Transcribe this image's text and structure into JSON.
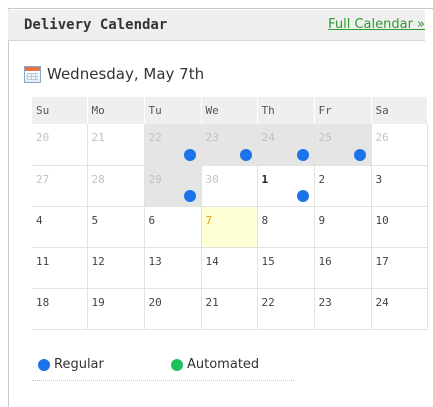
{
  "header": {
    "title": "Delivery Calendar",
    "full_calendar_link": "Full Calendar »"
  },
  "selected_date": "Wednesday, May 7th",
  "calendar": {
    "weekdays": [
      "Su",
      "Mo",
      "Tu",
      "We",
      "Th",
      "Fr",
      "Sa"
    ],
    "weeks": [
      [
        {
          "day": "20",
          "other": true
        },
        {
          "day": "21",
          "other": true
        },
        {
          "day": "22",
          "other": true,
          "shaded": true,
          "dot": "regular"
        },
        {
          "day": "23",
          "other": true,
          "shaded": true,
          "dot": "regular"
        },
        {
          "day": "24",
          "other": true,
          "shaded": true,
          "dot": "regular"
        },
        {
          "day": "25",
          "other": true,
          "shaded": true,
          "dot": "regular"
        },
        {
          "day": "26",
          "other": true
        }
      ],
      [
        {
          "day": "27",
          "other": true
        },
        {
          "day": "28",
          "other": true
        },
        {
          "day": "29",
          "other": true,
          "shaded": true,
          "dot": "regular"
        },
        {
          "day": "30",
          "other": true
        },
        {
          "day": "1",
          "first": true,
          "dot": "regular"
        },
        {
          "day": "2"
        },
        {
          "day": "3"
        }
      ],
      [
        {
          "day": "4"
        },
        {
          "day": "5"
        },
        {
          "day": "6"
        },
        {
          "day": "7",
          "today": true
        },
        {
          "day": "8"
        },
        {
          "day": "9"
        },
        {
          "day": "10"
        }
      ],
      [
        {
          "day": "11"
        },
        {
          "day": "12"
        },
        {
          "day": "13"
        },
        {
          "day": "14"
        },
        {
          "day": "15"
        },
        {
          "day": "16"
        },
        {
          "day": "17"
        }
      ],
      [
        {
          "day": "18"
        },
        {
          "day": "19"
        },
        {
          "day": "20"
        },
        {
          "day": "21"
        },
        {
          "day": "22"
        },
        {
          "day": "23"
        },
        {
          "day": "24"
        }
      ]
    ]
  },
  "legend": {
    "regular_label": "Regular",
    "automated_label": "Automated"
  },
  "colors": {
    "regular_dot": "#1a73e8",
    "automated_dot": "#1ec05a",
    "link_green": "#2f9a2f",
    "today_bg": "#ffffd6",
    "today_text": "#e0a020",
    "shaded_bg": "#e5e5e5"
  },
  "icons": {
    "date_icon": "calendar-icon"
  }
}
